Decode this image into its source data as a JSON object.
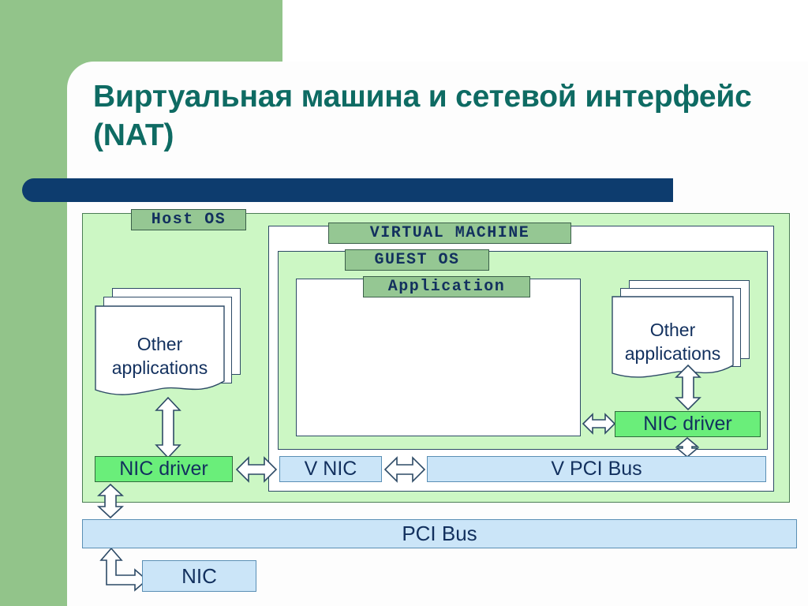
{
  "slide": {
    "title": "Виртуальная машина и сетевой интерфейс (NAT)",
    "accent_green": "#92c48a",
    "accent_navy": "#0d3c6e",
    "title_color": "#0e6b63"
  },
  "diagram": {
    "containers": {
      "host_os": "Host OS",
      "virtual_machine": "VIRTUAL MACHINE",
      "guest_os": "GUEST OS",
      "application": "Application"
    },
    "host_apps": {
      "line1": "Other",
      "line2": "applications"
    },
    "guest_apps": {
      "line1": "Other",
      "line2": "applications"
    },
    "boxes": {
      "nic_driver_host": "NIC driver",
      "nic_driver_guest": "NIC driver",
      "v_nic": "V NIC",
      "v_pci_bus": "V PCI Bus",
      "pci_bus": "PCI Bus",
      "nic": "NIC"
    },
    "colors": {
      "host_bg": "#ccf7c4",
      "guest_bg": "#ccf7c4",
      "vm_bg": "#ffffff",
      "nic_driver_fill": "#6aee7a",
      "bus_fill": "#cbe5f8",
      "tab_fill": "#95c793",
      "text": "#12305e"
    },
    "arrows": [
      {
        "name": "host-apps-to-nic-driver",
        "kind": "double-vertical"
      },
      {
        "name": "host-nic-driver-to-v-nic",
        "kind": "double-horizontal"
      },
      {
        "name": "v-nic-to-v-pci-bus",
        "kind": "double-horizontal"
      },
      {
        "name": "guest-apps-to-guest-nic-driver",
        "kind": "double-vertical"
      },
      {
        "name": "application-to-guest-nic-driver",
        "kind": "double-horizontal"
      },
      {
        "name": "guest-nic-driver-to-v-pci-bus",
        "kind": "double-vertical"
      },
      {
        "name": "host-nic-driver-to-pci-bus",
        "kind": "double-vertical"
      },
      {
        "name": "pci-bus-to-nic",
        "kind": "double-elbow"
      }
    ]
  }
}
